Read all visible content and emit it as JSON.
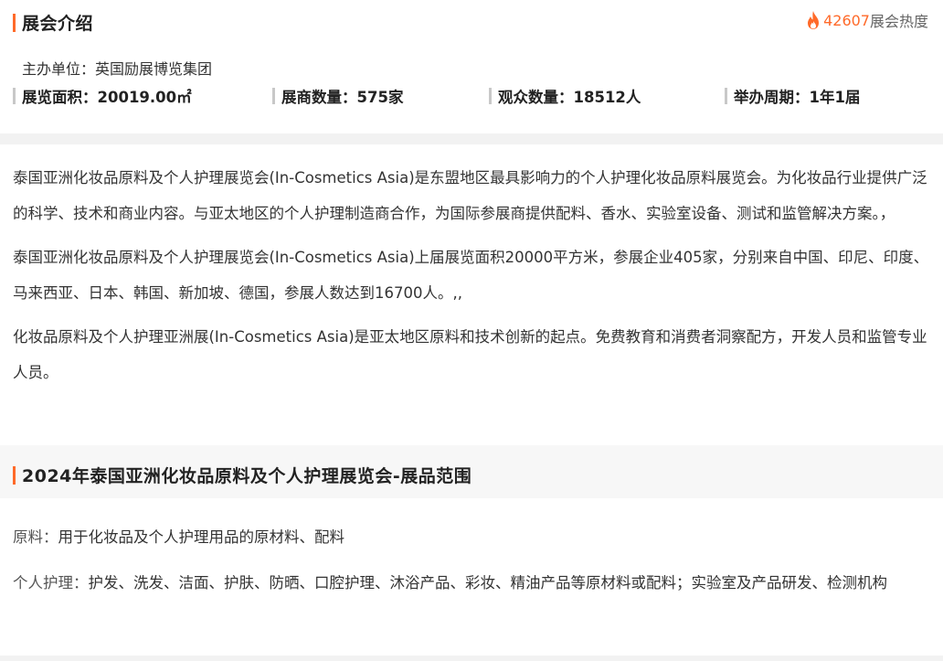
{
  "intro_section": {
    "title": "展会介绍",
    "heat": {
      "icon": "flame-icon",
      "count": "42607",
      "label": "展会热度"
    },
    "organizer": "主办单位：英国励展博览集团",
    "stats": [
      {
        "label": "展览面积：20019.00㎡"
      },
      {
        "label": "展商数量：575家"
      },
      {
        "label": "观众数量：18512人"
      },
      {
        "label": "举办周期：1年1届"
      }
    ],
    "paragraphs": [
      "泰国亚洲化妆品原料及个人护理展览会(In-Cosmetics Asia)是东盟地区最具影响力的个人护理化妆品原料展览会。为化妆品行业提供广泛的科学、技术和商业内容。与亚太地区的个人护理制造商合作，为国际参展商提供配料、香水、实验室设备、测试和监管解决方案。，",
      "泰国亚洲化妆品原料及个人护理展览会(In-Cosmetics Asia)上届展览面积20000平方米，参展企业405家，分别来自中国、印尼、印度、马来西亚、日本、韩国、新加坡、德国，参展人数达到16700人。,,",
      "化妆品原料及个人护理亚洲展(In-Cosmetics Asia)是亚太地区原料和技术创新的起点。免费教育和消费者洞察配方，开发人员和监管专业人员。"
    ]
  },
  "range_section": {
    "title": "2024年泰国亚洲化妆品原料及个人护理展览会-展品范围",
    "items": [
      {
        "key": "原料：",
        "value": "用于化妆品及个人护理用品的原材料、配料"
      },
      {
        "key": "个人护理：",
        "value": "护发、洗发、洁面、护肤、防晒、口腔护理、沐浴产品、彩妆、精油产品等原材料或配料；实验室及产品研发、检测机构"
      }
    ]
  },
  "colors": {
    "accent": "#ff6a2a",
    "text": "#333333",
    "divider": "#f2f2f2"
  }
}
